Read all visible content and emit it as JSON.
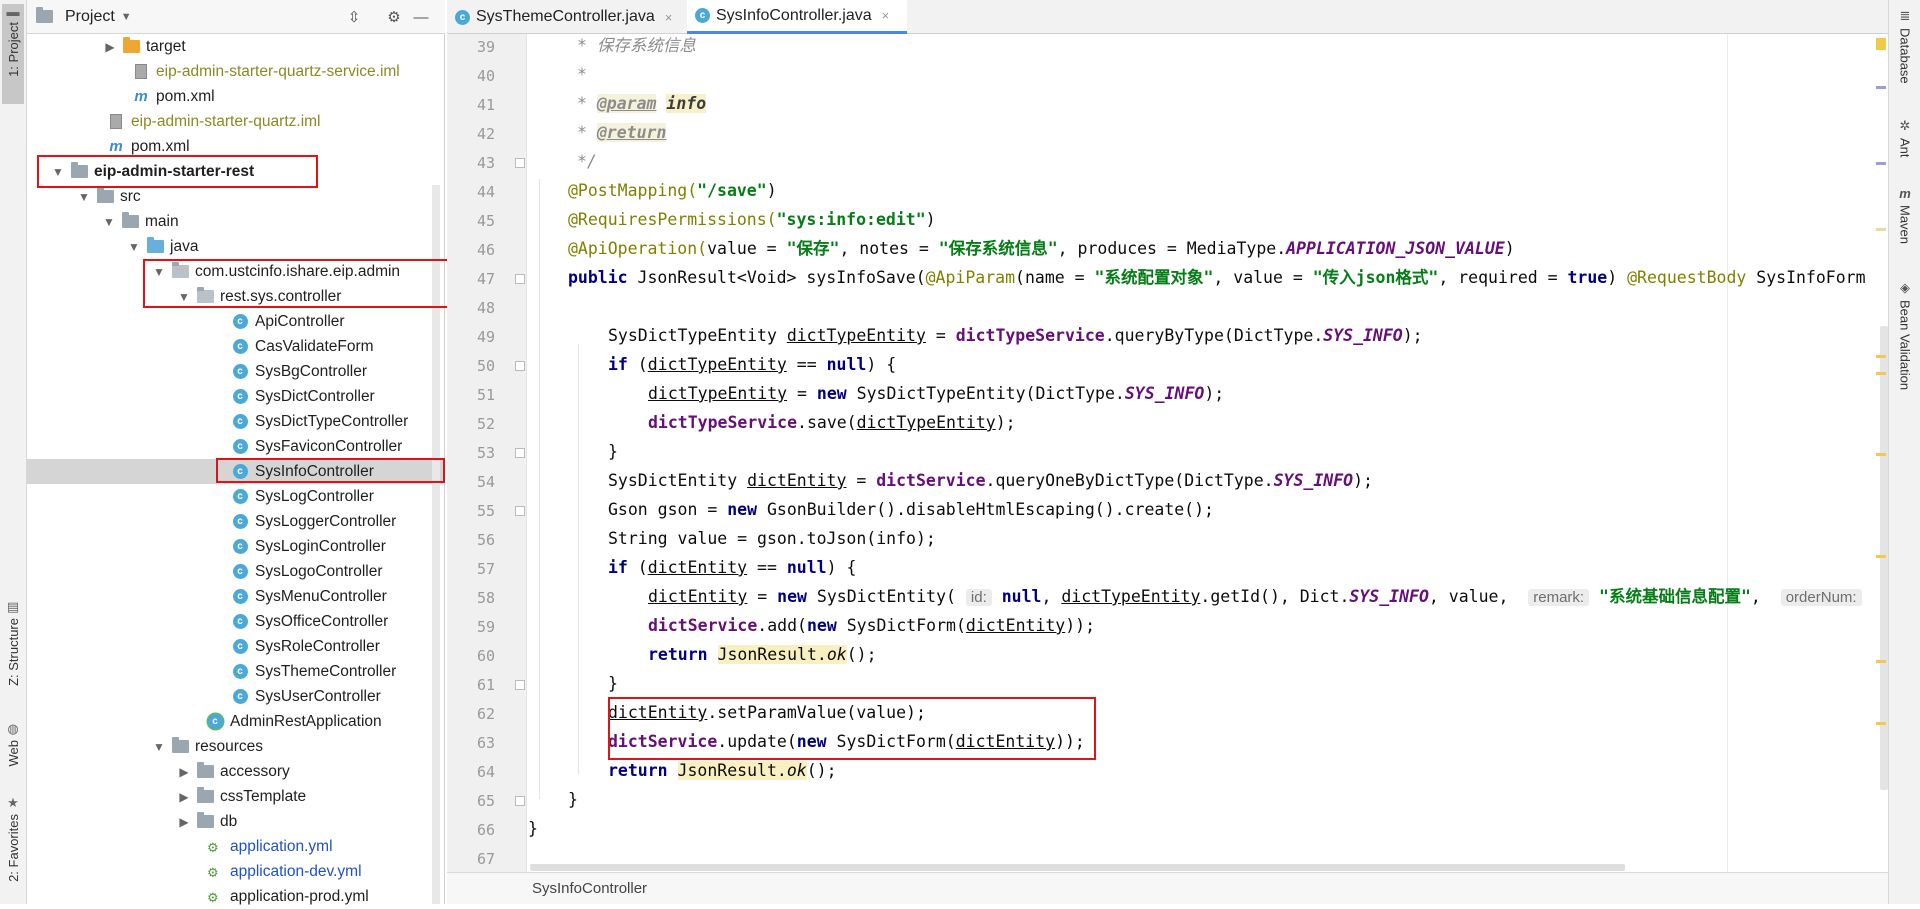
{
  "left_strip": {
    "tabs": [
      {
        "label": "1: Project",
        "icon": "folder-icon"
      },
      {
        "label": "Z: Structure",
        "icon": "structure-icon"
      },
      {
        "label": "Web",
        "icon": "globe-icon"
      },
      {
        "label": "2: Favorites",
        "icon": "star-icon"
      }
    ]
  },
  "project": {
    "title": "Project",
    "tree": [
      {
        "label": "target"
      },
      {
        "label": "eip-admin-starter-quartz-service.iml"
      },
      {
        "label": "pom.xml"
      },
      {
        "label": "eip-admin-starter-quartz.iml"
      },
      {
        "label": "pom.xml"
      },
      {
        "label": "eip-admin-starter-rest"
      },
      {
        "label": "src"
      },
      {
        "label": "main"
      },
      {
        "label": "java"
      },
      {
        "label": "com.ustcinfo.ishare.eip.admin"
      },
      {
        "label": "rest.sys.controller"
      },
      {
        "label": "ApiController"
      },
      {
        "label": "CasValidateForm"
      },
      {
        "label": "SysBgController"
      },
      {
        "label": "SysDictController"
      },
      {
        "label": "SysDictTypeController"
      },
      {
        "label": "SysFaviconController"
      },
      {
        "label": "SysInfoController"
      },
      {
        "label": "SysLogController"
      },
      {
        "label": "SysLoggerController"
      },
      {
        "label": "SysLoginController"
      },
      {
        "label": "SysLogoController"
      },
      {
        "label": "SysMenuController"
      },
      {
        "label": "SysOfficeController"
      },
      {
        "label": "SysRoleController"
      },
      {
        "label": "SysThemeController"
      },
      {
        "label": "SysUserController"
      },
      {
        "label": "AdminRestApplication"
      },
      {
        "label": "resources"
      },
      {
        "label": "accessory"
      },
      {
        "label": "cssTemplate"
      },
      {
        "label": "db"
      },
      {
        "label": "application.yml"
      },
      {
        "label": "application-dev.yml"
      },
      {
        "label": "application-prod.yml"
      }
    ]
  },
  "tabs": [
    {
      "label": "SysThemeController.java",
      "close": "×"
    },
    {
      "label": "SysInfoController.java",
      "close": "×"
    }
  ],
  "editor": {
    "line_numbers": [
      "39",
      "40",
      "41",
      "42",
      "43",
      "44",
      "45",
      "46",
      "47",
      "48",
      "49",
      "50",
      "51",
      "52",
      "53",
      "54",
      "55",
      "56",
      "57",
      "58",
      "59",
      "60",
      "61",
      "62",
      "63",
      "64",
      "65",
      "66",
      "67"
    ],
    "lines": {
      "l39": "* 保存系统信息",
      "l40": "*",
      "l41a": "* ",
      "l41b": "@param",
      "l41c": "info",
      "l42a": "* ",
      "l42b": "@return",
      "l43": "*/",
      "l44a": "@PostMapping(",
      "l44b": "\"/save\"",
      "l44c": ")",
      "l45a": "@RequiresPermissions(",
      "l45b": "\"sys:info:edit\"",
      "l45c": ")",
      "l46a": "@ApiOperation(",
      "l46b": "value = ",
      "l46c": "\"保存\"",
      "l46d": ", notes = ",
      "l46e": "\"保存系统信息\"",
      "l46f": ", produces = MediaType.",
      "l46g": "APPLICATION_JSON_VALUE",
      "l46h": ")",
      "l47a": "public",
      "l47b": " JsonResult<Void> sysInfoSave(",
      "l47c": "@ApiParam",
      "l47d": "(name = ",
      "l47e": "\"系统配置对象\"",
      "l47f": ", value = ",
      "l47g": "\"传入json格式\"",
      "l47h": ", required = ",
      "l47i": "true",
      "l47j": ") ",
      "l47k": "@RequestBody",
      "l47l": " SysInfoForm",
      "l49a": "SysDictTypeEntity ",
      "l49b": "dictTypeEntity",
      "l49c": " = ",
      "l49d": "dictTypeService",
      "l49e": ".queryByType(DictType.",
      "l49f": "SYS_INFO",
      "l49g": ");",
      "l50a": "if",
      "l50b": " (",
      "l50c": "dictTypeEntity",
      "l50d": " == ",
      "l50e": "null",
      "l50f": ") {",
      "l51a": "dictTypeEntity",
      "l51b": " = ",
      "l51c": "new",
      "l51d": " SysDictTypeEntity(DictType.",
      "l51e": "SYS_INFO",
      "l51f": ");",
      "l52a": "dictTypeService",
      "l52b": ".save(",
      "l52c": "dictTypeEntity",
      "l52d": ");",
      "l53": "}",
      "l54a": "SysDictEntity ",
      "l54b": "dictEntity",
      "l54c": " = ",
      "l54d": "dictService",
      "l54e": ".queryOneByDictType(DictType.",
      "l54f": "SYS_INFO",
      "l54g": ");",
      "l55a": "Gson gson = ",
      "l55b": "new",
      "l55c": " GsonBuilder().disableHtmlEscaping().create();",
      "l56": "String value = gson.toJson(info);",
      "l57a": "if",
      "l57b": " (",
      "l57c": "dictEntity",
      "l57d": " == ",
      "l57e": "null",
      "l57f": ") {",
      "l58a": "dictEntity",
      "l58b": " = ",
      "l58c": "new",
      "l58d": " SysDictEntity(",
      "l58hint1": "id:",
      "l58e": "null",
      "l58f": ", ",
      "l58g": "dictTypeEntity",
      "l58h": ".getId(), Dict.",
      "l58i": "SYS_INFO",
      "l58j": ", value, ",
      "l58hint2": "remark:",
      "l58k": "\"系统基础信息配置\"",
      "l58l": ", ",
      "l58hint3": "orderNum:",
      "l59a": "dictService",
      "l59b": ".add(",
      "l59c": "new",
      "l59d": " SysDictForm(",
      "l59e": "dictEntity",
      "l59f": "));",
      "l60a": "return",
      "l60b": " ",
      "l60c": "JsonResult",
      "l60d": ".",
      "l60e": "ok",
      "l60f": "();",
      "l61": "}",
      "l62a": "dictEntity",
      "l62b": ".setParamValue(value);",
      "l63a": "dictService",
      "l63b": ".update(",
      "l63c": "new",
      "l63d": " SysDictForm(",
      "l63e": "dictEntity",
      "l63f": "));",
      "l64a": "return",
      "l64b": " ",
      "l64c": "JsonResult",
      "l64d": ".",
      "l64e": "ok",
      "l64f": "();",
      "l65": "}",
      "l66": "}"
    }
  },
  "status": {
    "breadcrumb": "SysInfoController"
  },
  "right_strip": {
    "tabs": [
      {
        "label": "Database",
        "icon": "database-icon"
      },
      {
        "label": "Ant",
        "icon": "ant-icon"
      },
      {
        "label": "Maven",
        "icon": "maven-icon"
      },
      {
        "label": "Bean Validation",
        "icon": "bean-validation-icon"
      }
    ]
  },
  "colors": {
    "highlight_box": "#e01414",
    "keyword": "#000080",
    "string": "#067d17",
    "annotation": "#808000",
    "field": "#660e7a"
  }
}
